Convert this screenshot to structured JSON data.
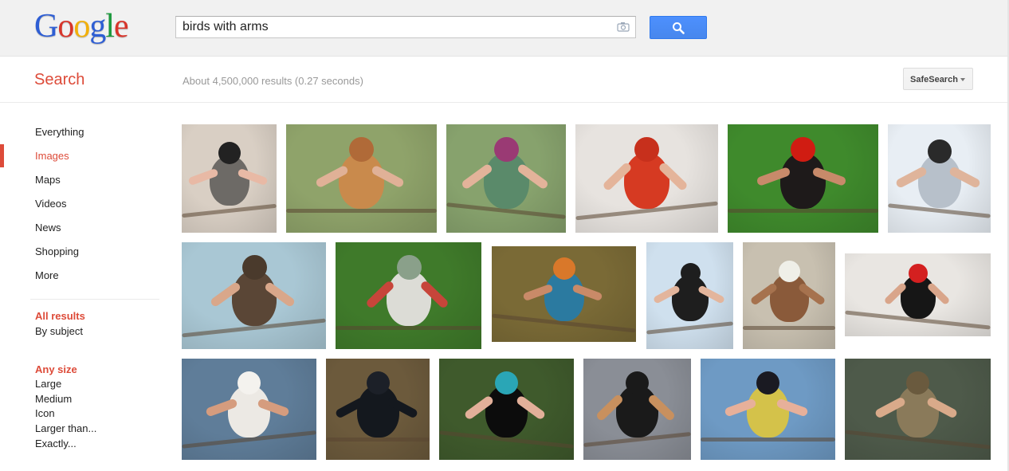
{
  "logo": {
    "letters": [
      {
        "ch": "G",
        "color": "#2e5ed4"
      },
      {
        "ch": "o",
        "color": "#d8352b"
      },
      {
        "ch": "o",
        "color": "#f2b00a"
      },
      {
        "ch": "g",
        "color": "#2e5ed4"
      },
      {
        "ch": "l",
        "color": "#1a9a3c"
      },
      {
        "ch": "e",
        "color": "#d8352b"
      }
    ]
  },
  "search": {
    "query": "birds with arms",
    "camera_icon": "camera-icon",
    "button_icon": "magnifier-icon"
  },
  "subheader": {
    "title": "Search",
    "stats": "About 4,500,000 results (0.27 seconds)",
    "safesearch_label": "SafeSearch"
  },
  "nav": {
    "items": [
      {
        "label": "Everything",
        "selected": false
      },
      {
        "label": "Images",
        "selected": true
      },
      {
        "label": "Maps",
        "selected": false
      },
      {
        "label": "Videos",
        "selected": false
      },
      {
        "label": "News",
        "selected": false
      },
      {
        "label": "Shopping",
        "selected": false
      },
      {
        "label": "More",
        "selected": false
      }
    ],
    "results_group": {
      "heading": "All results",
      "options": [
        "By subject"
      ]
    },
    "size_group": {
      "heading": "Any size",
      "options": [
        "Large",
        "Medium",
        "Icon",
        "Larger than...",
        "Exactly..."
      ]
    }
  },
  "images": [
    {
      "name": "bulbul-arms",
      "bg": "#d9cfc4",
      "bird": "#6d6a66",
      "head": "#222",
      "arm": "#e8b9a5"
    },
    {
      "name": "robin-keyboard",
      "bg": "#8fa36a",
      "bird": "#c98a4c",
      "head": "#b06a38",
      "arm": "#e0b197"
    },
    {
      "name": "hummingbird-arms",
      "bg": "#87a26d",
      "bird": "#5a8a6a",
      "head": "#9a3a74",
      "arm": "#e3b39a"
    },
    {
      "name": "cardinal-binoculars",
      "bg": "#e7e3df",
      "bird": "#d63a22",
      "head": "#c7301c",
      "arm": "#e4b49a"
    },
    {
      "name": "muscle-bird",
      "bg": "#3f8a2c",
      "bird": "#1e1a1a",
      "head": "#d01c12",
      "arm": "#c88a6a"
    },
    {
      "name": "penguin-thumbs",
      "bg": "#e8eef4",
      "bird": "#b7c0ca",
      "head": "#2a2a2a",
      "arm": "#dfb49b"
    },
    {
      "name": "kiwi-muscles",
      "bg": "#a9c7d4",
      "bird": "#5a4636",
      "head": "#4a3a2c",
      "arm": "#d9a78a"
    },
    {
      "name": "hummingbird-hands",
      "bg": "#3f7a2a",
      "bird": "#dcdcd6",
      "head": "#8aa08a",
      "arm": "#c7453a"
    },
    {
      "name": "kingfishers-hug",
      "bg": "#7a6a36",
      "bird": "#2b7aa0",
      "head": "#d9782a",
      "arm": "#c98a68"
    },
    {
      "name": "penguin-conductor",
      "bg": "#cfe0ee",
      "bird": "#1e1e1e",
      "head": "#1e1e1e",
      "arm": "#e3b59c"
    },
    {
      "name": "eagle-muscles",
      "bg": "#c8c0b0",
      "bird": "#8a5a3a",
      "head": "#efefe8",
      "arm": "#a6724e"
    },
    {
      "name": "frigatebird-arms",
      "bg": "#e9e6e2",
      "bird": "#161616",
      "head": "#d42020",
      "arm": "#d9a58a"
    },
    {
      "name": "gull-stretch",
      "bg": "#5f7d99",
      "bird": "#ece9e4",
      "head": "#f4f2ee",
      "arm": "#d59c7e"
    },
    {
      "name": "vader-bird",
      "bg": "#6c5a3c",
      "bird": "#14181e",
      "head": "#1c2028",
      "arm": "#14181e"
    },
    {
      "name": "paradise-bird-hands",
      "bg": "#3f5a2c",
      "bird": "#0c0c0c",
      "head": "#2aa6b6",
      "arm": "#e3b09a"
    },
    {
      "name": "crow-hanging",
      "bg": "#8a8e96",
      "bird": "#1a1a1a",
      "head": "#1a1a1a",
      "arm": "#c8905e"
    },
    {
      "name": "tit-hand",
      "bg": "#6e9ac4",
      "bird": "#d4c24a",
      "head": "#1a1a22",
      "arm": "#e7b09a"
    },
    {
      "name": "duck-handstand",
      "bg": "#4e5a4a",
      "bird": "#8a7a5a",
      "head": "#6a5a3e",
      "arm": "#d9aa8a"
    }
  ]
}
